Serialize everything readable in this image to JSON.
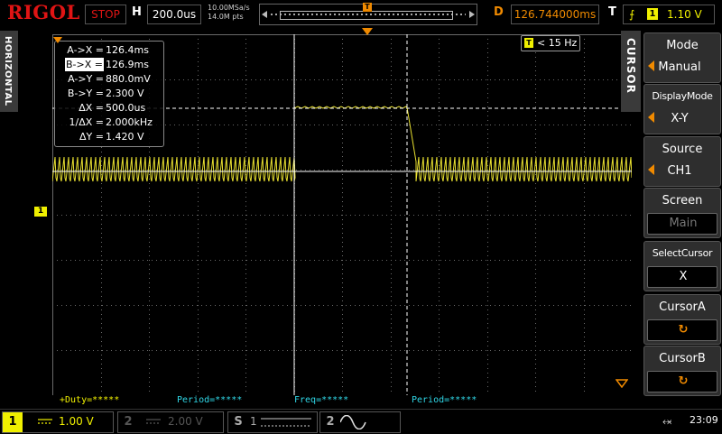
{
  "top": {
    "brand": "RIGOL",
    "run_state": "STOP",
    "h_label": "H",
    "timebase": "200.0us",
    "sample_rate": "10.00MSa/s",
    "mem_depth": "14.0M pts",
    "trig_marker": "T",
    "d_label": "D",
    "delay": "126.744000ms",
    "t_label": "T",
    "trigger_channel": "1",
    "trigger_level": "1.10 V",
    "trigger_edge_icon": "rising-edge-icon"
  },
  "left_tab": "HORIZONTAL",
  "ch1_marker": "1",
  "freq_counter": {
    "t": "T",
    "value": "< 15 Hz"
  },
  "readout": [
    {
      "key": "A->X =",
      "value": "126.4ms",
      "highlight": false
    },
    {
      "key": "B->X =",
      "value": "126.9ms",
      "highlight": true
    },
    {
      "key": "A->Y =",
      "value": "880.0mV",
      "highlight": false
    },
    {
      "key": "B->Y =",
      "value": "2.300 V",
      "highlight": false
    },
    {
      "key": "ΔX =",
      "value": "500.0us",
      "highlight": false
    },
    {
      "key": "1/ΔX =",
      "value": "2.000kHz",
      "highlight": false
    },
    {
      "key": "ΔY =",
      "value": "1.420 V",
      "highlight": false
    }
  ],
  "measurements": {
    "m1": "+Duty=*****",
    "m2": "Period=*****",
    "m3": "Freq=*****",
    "m4": "Period=*****"
  },
  "menu": {
    "tab": "CURSOR",
    "items": [
      {
        "title": "Mode",
        "value": "Manual"
      },
      {
        "title": "DisplayMode",
        "value": "X-Y"
      },
      {
        "title": "Source",
        "value": "CH1"
      },
      {
        "title": "Screen",
        "value": "Main"
      },
      {
        "title": "SelectCursor",
        "value": "X"
      },
      {
        "title": "CursorA",
        "value": "↻"
      },
      {
        "title": "CursorB",
        "value": "↻"
      }
    ]
  },
  "bottom": {
    "ch1": {
      "num": "1",
      "coupling_icon": "dc-coupling-icon",
      "scale": "1.00 V"
    },
    "ch2": {
      "num": "2",
      "coupling_icon": "dc-coupling-icon",
      "scale": "2.00 V"
    },
    "s": {
      "num": "S",
      "sub": "1"
    },
    "m": {
      "num": "2"
    },
    "usb_icon": "usb-icon",
    "time": "23:09"
  },
  "colors": {
    "ch1": "#f0f000",
    "accent": "#f08a00",
    "brand": "#e01414",
    "measure_cyan": "#30d8e8"
  }
}
